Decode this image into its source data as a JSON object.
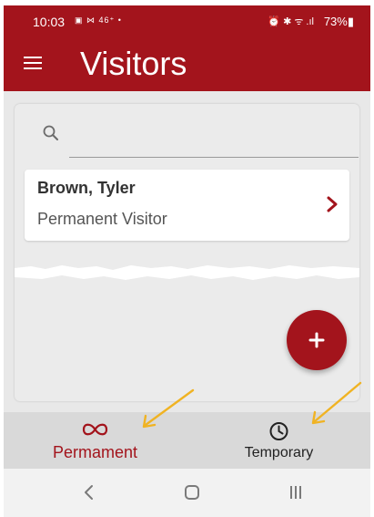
{
  "status_bar": {
    "time": "10:03",
    "left_icons": "▣ ⋈ 46⁺ •",
    "right_icons": "⏰ ✱ ᯤ .ıl",
    "battery": "73%▮"
  },
  "header": {
    "title": "Visitors",
    "menu_icon": "hamburger-menu-icon",
    "background_color": "#a3141c"
  },
  "search": {
    "value": "",
    "placeholder": "",
    "icon": "search-icon"
  },
  "visitors": [
    {
      "name": "Brown, Tyler",
      "type": "Permanent Visitor"
    }
  ],
  "fab": {
    "icon": "plus-icon",
    "color": "#a3141c"
  },
  "tabs": [
    {
      "label": "Permament",
      "icon": "infinity-icon",
      "selected": true,
      "color": "#a3141c"
    },
    {
      "label": "Temporary",
      "icon": "clock-icon",
      "selected": false,
      "color": "#222222"
    }
  ],
  "annotations": {
    "arrow_color": "#f0b323"
  },
  "nav_bar": {
    "buttons": [
      "back-icon",
      "home-icon",
      "recents-icon"
    ]
  }
}
